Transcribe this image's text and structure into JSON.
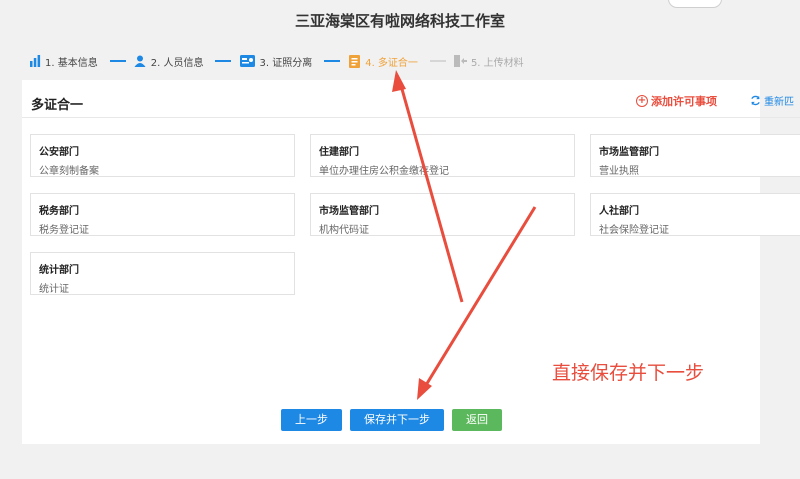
{
  "header": {
    "company_title": "三亚海棠区有啦网络科技工作室"
  },
  "steps": [
    {
      "label": "1. 基本信息",
      "icon": "bar-chart-icon",
      "state": "done"
    },
    {
      "label": "2. 人员信息",
      "icon": "person-icon",
      "state": "done"
    },
    {
      "label": "3. 证照分离",
      "icon": "id-card-icon",
      "state": "done"
    },
    {
      "label": "4. 多证合一",
      "icon": "document-icon",
      "state": "active"
    },
    {
      "label": "5. 上传材料",
      "icon": "upload-icon",
      "state": "pending"
    }
  ],
  "section": {
    "title": "多证合一",
    "add_label": "添加许可事项",
    "rematch_label": "重新匹"
  },
  "cards": [
    {
      "dept": "公安部门",
      "item": "公章刻制备案"
    },
    {
      "dept": "住建部门",
      "item": "单位办理住房公积金缴存登记"
    },
    {
      "dept": "市场监管部门",
      "item": "营业执照"
    },
    {
      "dept": "税务部门",
      "item": "税务登记证"
    },
    {
      "dept": "市场监管部门",
      "item": "机构代码证"
    },
    {
      "dept": "人社部门",
      "item": "社会保险登记证"
    },
    {
      "dept": "统计部门",
      "item": "统计证"
    }
  ],
  "buttons": {
    "prev": "上一步",
    "save_next": "保存并下一步",
    "back": "返回"
  },
  "annotation": {
    "text": "直接保存并下一步",
    "color": "#e84d3d"
  },
  "colors": {
    "primary": "#1e88e5",
    "success": "#5cb85c",
    "active_step": "#f0a23a",
    "danger": "#e84d3d"
  }
}
